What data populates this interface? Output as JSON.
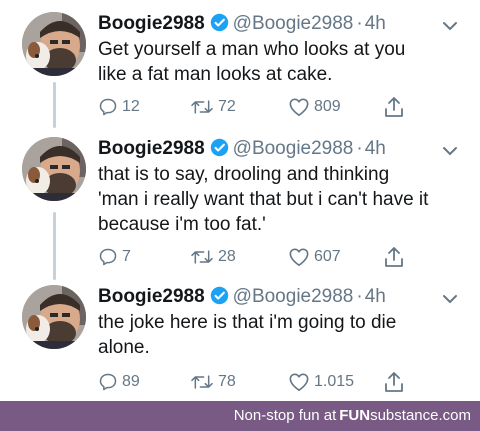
{
  "tweets": [
    {
      "name": "Boogie2988",
      "handle": "@Boogie2988",
      "separator": "·",
      "time": "4h",
      "text": "Get yourself a man who looks at you\nlike a fat man looks at cake.",
      "replies": "12",
      "retweets": "72",
      "likes": "809"
    },
    {
      "name": "Boogie2988",
      "handle": "@Boogie2988",
      "separator": "·",
      "time": "4h",
      "text": "that is to say, drooling and thinking\n'man i really want that but i can't have it\nbecause i'm too fat.'",
      "replies": "7",
      "retweets": "28",
      "likes": "607"
    },
    {
      "name": "Boogie2988",
      "handle": "@Boogie2988",
      "separator": "·",
      "time": "4h",
      "text": "the joke here is that i'm going to die\nalone.",
      "replies": "89",
      "retweets": "78",
      "likes": "1.015"
    }
  ],
  "footer": {
    "text": "Non-stop fun at",
    "brand_part1": "FUN",
    "brand_part2": "substance",
    "brand_part3": ".com"
  },
  "colors": {
    "verified": "#1da1f2",
    "icon": "#657786",
    "footer_bg": "#785a84",
    "thread_line": "#c8d0d8"
  },
  "icons": [
    "verified-badge-icon",
    "chevron-down-icon",
    "reply-icon",
    "retweet-icon",
    "like-icon",
    "share-icon"
  ]
}
